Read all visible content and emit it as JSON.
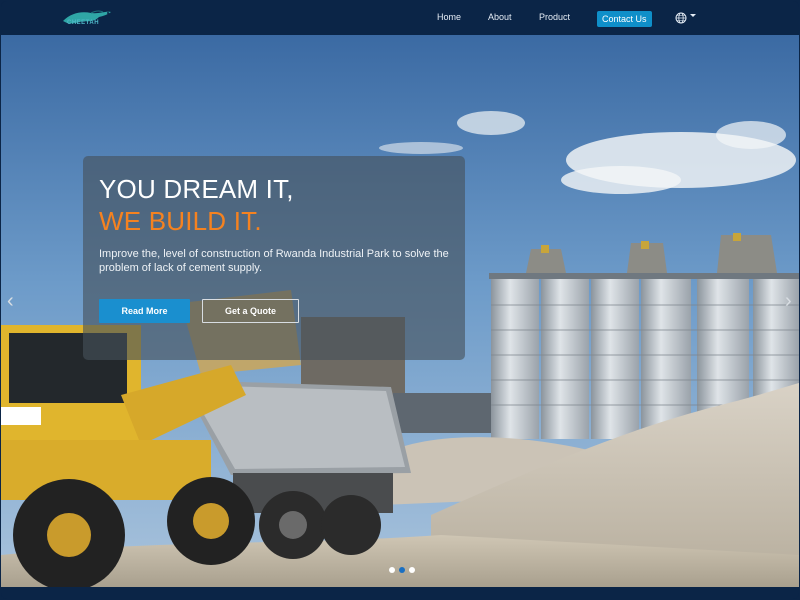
{
  "brand": {
    "logo_text": "CHEETAH"
  },
  "nav": {
    "home": "Home",
    "about": "About",
    "product": "Product",
    "contact": "Contact Us",
    "language_icon": "globe-icon"
  },
  "hero": {
    "headline_line1": "YOU DREAM IT,",
    "headline_line2": "WE BUILD IT.",
    "description": "Improve the, level of construction of Rwanda Industrial Park to solve the problem of lack of cement supply.",
    "read_more": "Read More",
    "get_quote": "Get a Quote",
    "prev_icon": "chevron-left-icon",
    "next_icon": "chevron-right-icon",
    "slides_total": 3,
    "active_slide": 2
  },
  "colors": {
    "navbar": "#0b2547",
    "accent_blue": "#1a8fcf",
    "accent_orange": "#f58220"
  }
}
